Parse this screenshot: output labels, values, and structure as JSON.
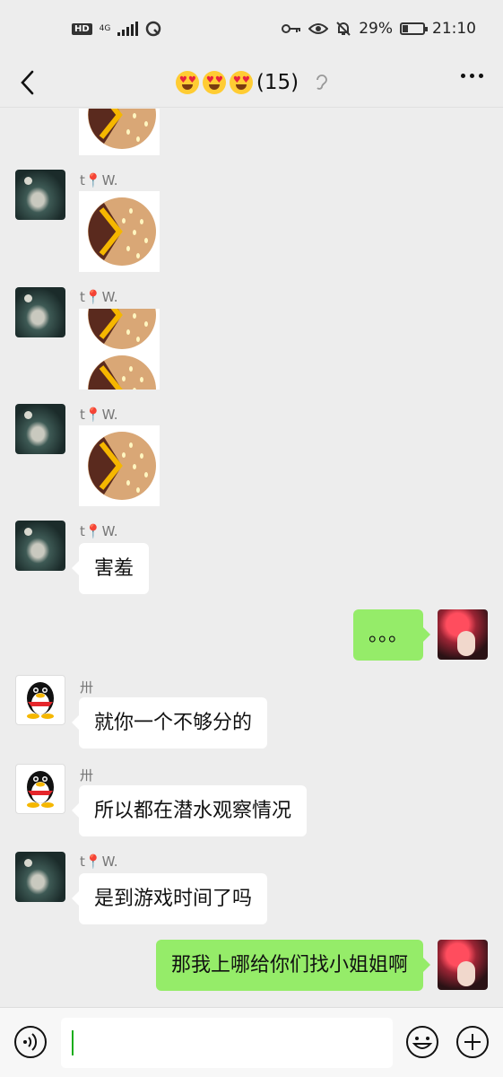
{
  "status_bar": {
    "hd": "HD",
    "network": "4G",
    "battery_percent": "29%",
    "battery_level": 0.29,
    "time": "21:10"
  },
  "header": {
    "title_count": "(15)",
    "back_icon": "chevron-left-icon",
    "mute_icon": "ear-icon",
    "more_icon": "more-dots-icon"
  },
  "messages": [
    {
      "sender": "t📍W.",
      "type": "sticker",
      "sticker": "burger-sticker"
    },
    {
      "sender": "t📍W.",
      "type": "sticker",
      "sticker": "burger-sticker"
    },
    {
      "sender": "t📍W.",
      "type": "sticker",
      "sticker": "burger-sticker"
    },
    {
      "sender": "t📍W.",
      "type": "text",
      "text": "害羞"
    },
    {
      "sender": "me",
      "type": "text",
      "text": "。。。"
    },
    {
      "sender": "卅",
      "type": "text",
      "text": "就你一个不够分的"
    },
    {
      "sender": "卅",
      "type": "text",
      "text": "所以都在潜水观察情况"
    },
    {
      "sender": "t📍W.",
      "type": "text",
      "text": "是到游戏时间了吗"
    },
    {
      "sender": "me",
      "type": "text",
      "text": "那我上哪给你们找小姐姐啊"
    }
  ],
  "sender_labels": {
    "tw_prefix": "t",
    "tw_pin": "📍",
    "tw_suffix": "W.",
    "qq_user": "卅"
  },
  "input_bar": {
    "voice_icon": "voice-icon",
    "emoji_icon": "emoji-icon",
    "plus_icon": "plus-icon",
    "value": ""
  },
  "colors": {
    "background": "#ededed",
    "outgoing_bubble": "#95ec69",
    "incoming_bubble": "#ffffff"
  }
}
